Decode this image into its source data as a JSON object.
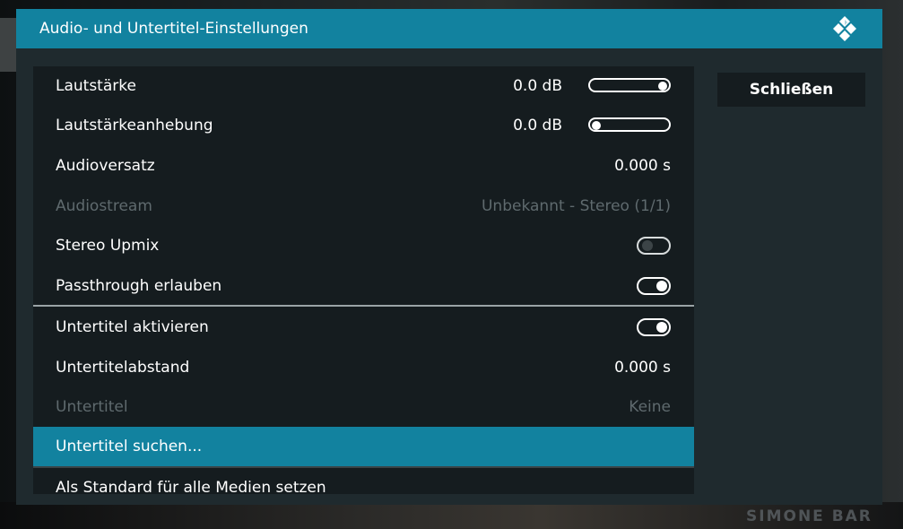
{
  "dialog": {
    "title": "Audio- und Untertitel-Einstellungen",
    "close_label": "Schließen",
    "icon": "kodi-logo-icon"
  },
  "settings": {
    "volume": {
      "label": "Lautstärke",
      "value": "0.0 dB",
      "slider_level": 1.0
    },
    "volume_amplification": {
      "label": "Lautstärkeanhebung",
      "value": "0.0 dB",
      "slider_level": 0.0
    },
    "audio_offset": {
      "label": "Audioversatz",
      "value": "0.000 s"
    },
    "audio_stream": {
      "label": "Audiostream",
      "value": "Unbekannt - Stereo (1/1)",
      "enabled": false
    },
    "stereo_upmix": {
      "label": "Stereo Upmix",
      "toggle": false
    },
    "passthrough": {
      "label": "Passthrough erlauben",
      "toggle": true
    },
    "subtitles_enable": {
      "label": "Untertitel aktivieren",
      "toggle": true
    },
    "subtitle_offset": {
      "label": "Untertitelabstand",
      "value": "0.000 s"
    },
    "subtitle": {
      "label": "Untertitel",
      "value": "Keine",
      "enabled": false
    },
    "subtitle_search": {
      "label": "Untertitel suchen...",
      "focused": true
    },
    "set_default": {
      "label": "Als Standard für alle Medien setzen"
    }
  },
  "background": {
    "watermark": "SIMONE BAR"
  },
  "colors": {
    "accent": "#12829f",
    "panel": "#1f2a2e",
    "list_bg": "#151c1f",
    "disabled_text": "#5f6a6e"
  }
}
